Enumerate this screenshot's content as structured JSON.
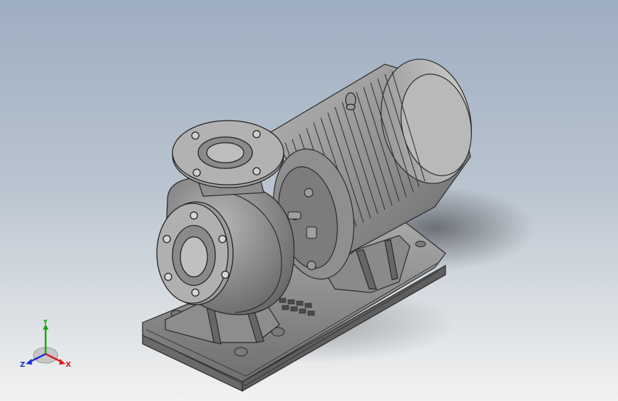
{
  "viewport": {
    "background_top": "#9eaec1",
    "background_bottom": "#f2f2f2"
  },
  "model": {
    "body_color": "#8c8c8c",
    "edge_color": "#2a2a2a"
  },
  "triad": {
    "x_label": "X",
    "y_label": "Y",
    "z_label": "Z",
    "x_color": "#d81e1e",
    "y_color": "#19a619",
    "z_color": "#1e2fd8"
  }
}
